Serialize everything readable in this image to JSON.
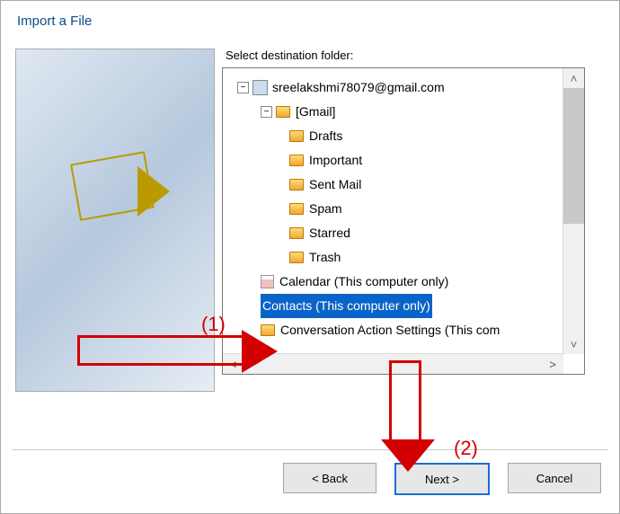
{
  "title": "Import a File",
  "panel_label": "Select destination folder:",
  "account": "sreelakshmi78079@gmail.com",
  "gmail_label": "[Gmail]",
  "folders": [
    "Drafts",
    "Important",
    "Sent Mail",
    "Spam",
    "Starred",
    "Trash"
  ],
  "calendar": "Calendar (This computer only)",
  "contacts": "Contacts (This computer only)",
  "conv": "Conversation Action Settings (This com",
  "annotations": {
    "one": "(1)",
    "two": "(2)"
  },
  "buttons": {
    "back": "<  Back",
    "next": "Next  >",
    "cancel": "Cancel"
  }
}
